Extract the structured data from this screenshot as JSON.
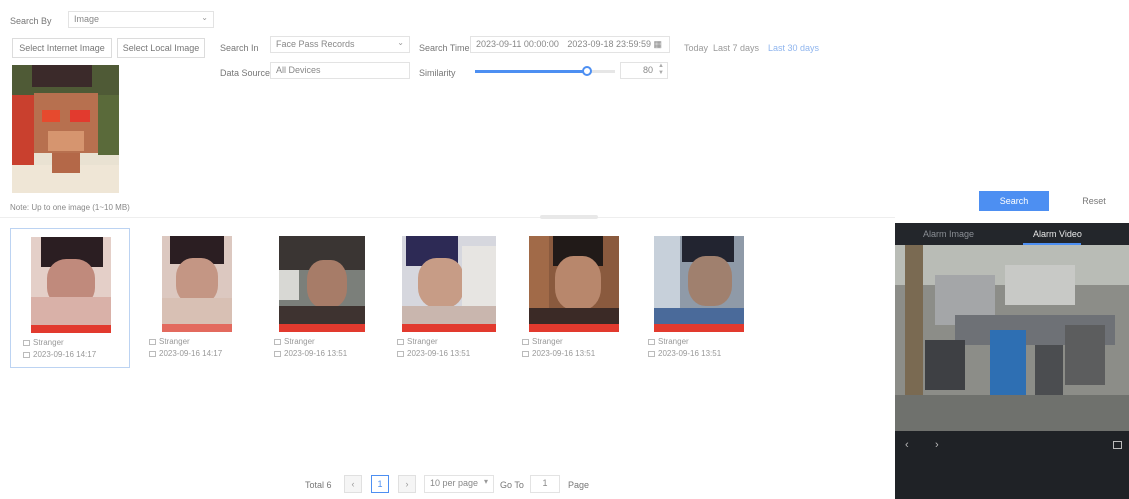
{
  "search": {
    "search_by_label": "Search By",
    "search_by_value": "Image",
    "select_internet_image_label": "Select Internet Image",
    "select_local_image_label": "Select Local Image",
    "search_in_label": "Search In",
    "search_in_value": "Face Pass Records",
    "search_time_label": "Search Time",
    "time_start": "2023-09-11 00:00:00",
    "time_end": "2023-09-18 23:59:59",
    "today_label": "Today",
    "last7_label": "Last 7 days",
    "last30_label": "Last 30 days",
    "data_source_label": "Data Source",
    "data_source_value": "All Devices",
    "similarity_label": "Similarity",
    "similarity_value": "80",
    "similarity_fraction": 0.8,
    "note": "Note: Up to one image (1~10 MB)",
    "search_button": "Search",
    "reset_button": "Reset"
  },
  "results": [
    {
      "title": "Stranger",
      "time": "2023-09-16 14:17"
    },
    {
      "title": "Stranger",
      "time": "2023-09-16 14:17"
    },
    {
      "title": "Stranger",
      "time": "2023-09-16 13:51"
    },
    {
      "title": "Stranger",
      "time": "2023-09-16 13:51"
    },
    {
      "title": "Stranger",
      "time": "2023-09-16 13:51"
    },
    {
      "title": "Stranger",
      "time": "2023-09-16 13:51"
    }
  ],
  "pagination": {
    "total": "Total 6",
    "current_page": "1",
    "per_page": "10 per page",
    "goto_label": "Go To",
    "goto_value": "1",
    "page_label": "Page"
  },
  "preview": {
    "tab_image": "Alarm Image",
    "tab_video": "Alarm Video"
  }
}
